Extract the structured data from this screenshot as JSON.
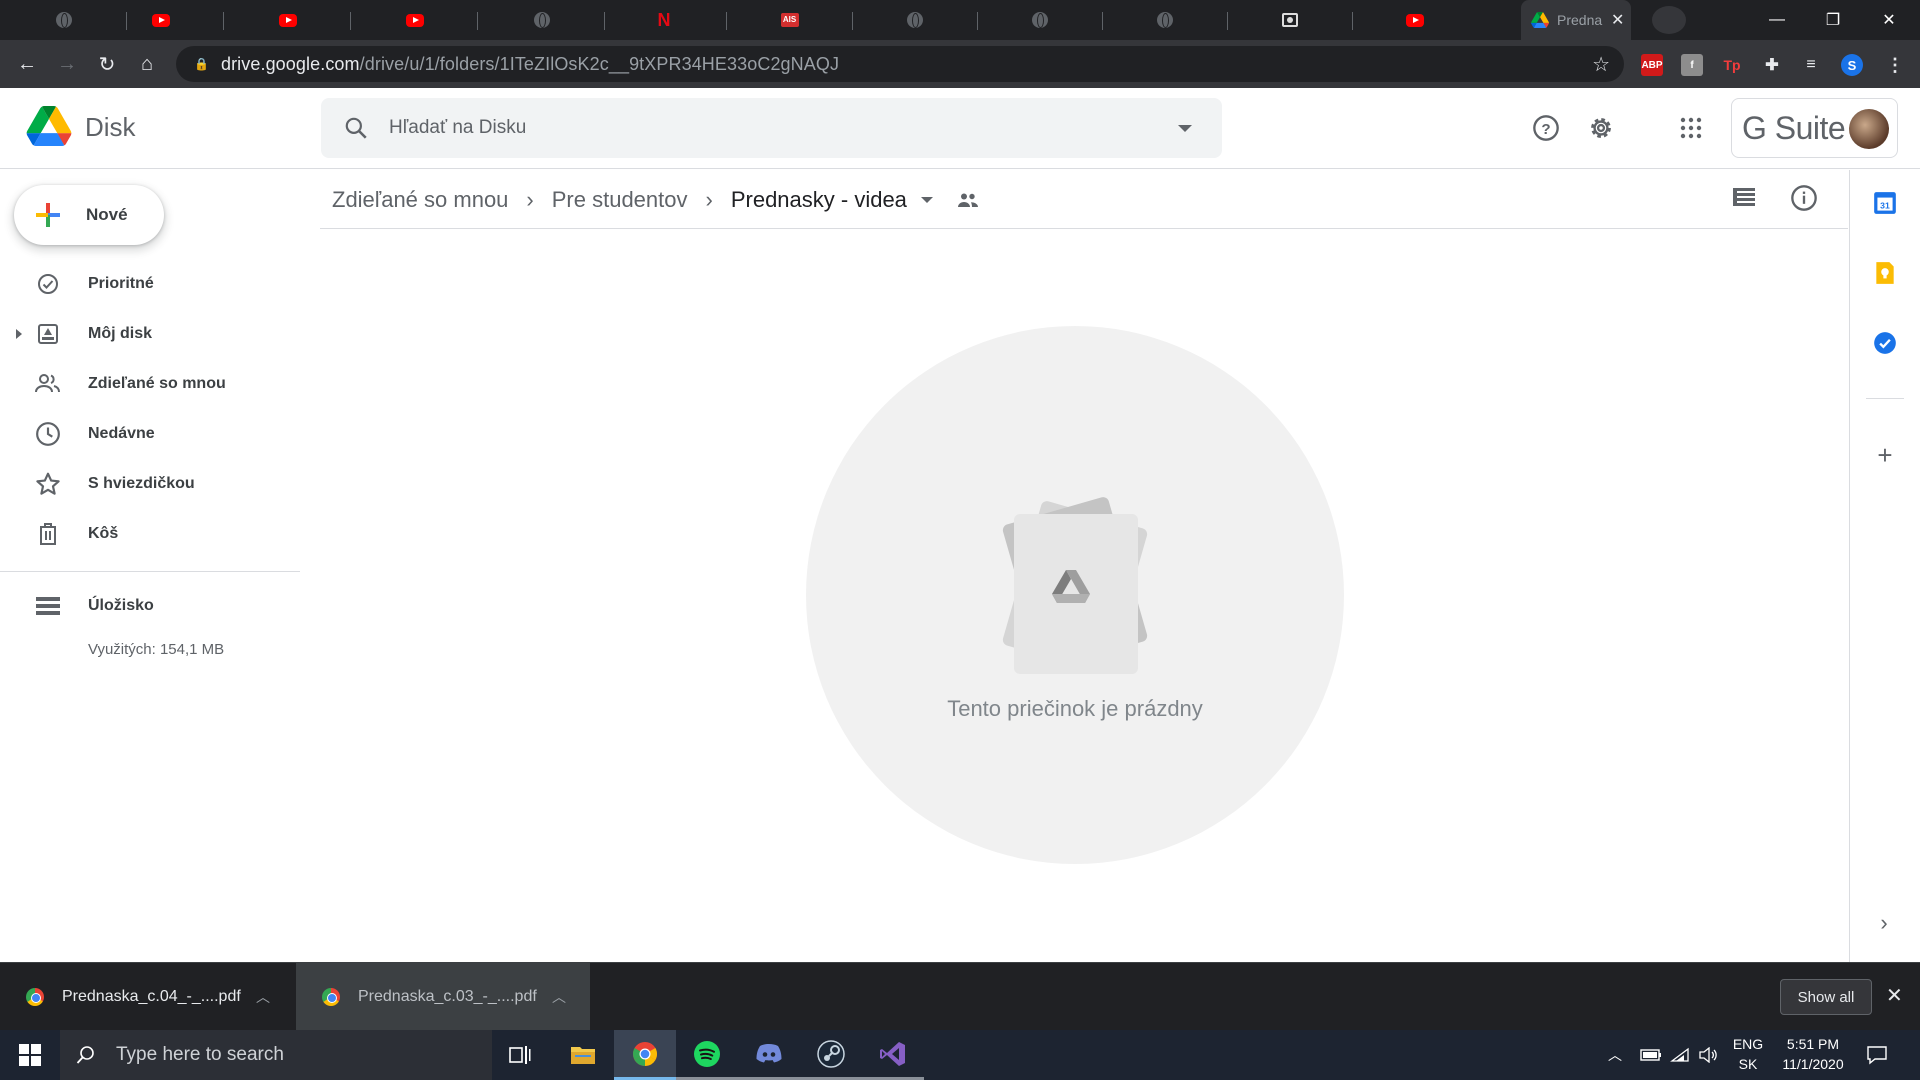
{
  "browser": {
    "tabs": [
      {
        "icon": "globe-icon"
      },
      {
        "icon": "youtube-icon"
      },
      {
        "icon": "youtube-icon"
      },
      {
        "icon": "youtube-icon"
      },
      {
        "icon": "globe-icon"
      },
      {
        "icon": "netflix-icon"
      },
      {
        "icon": "ais-icon"
      },
      {
        "icon": "globe-icon"
      },
      {
        "icon": "globe-icon"
      },
      {
        "icon": "globe-icon"
      },
      {
        "icon": "contact-icon"
      },
      {
        "icon": "youtube-icon"
      }
    ],
    "active_tab": {
      "title": "Predna",
      "icon": "google-drive-icon"
    },
    "url": {
      "host": "drive.google.com",
      "path": "/drive/u/1/folders/1ITeZIlOsK2c__9tXPR34HE33oC2gNAQJ"
    },
    "extensions": [
      "ABP",
      "f",
      "Tp"
    ],
    "profile_initial": "S"
  },
  "drive": {
    "app_name": "Disk",
    "search": {
      "placeholder": "Hľadať na Disku"
    },
    "gsuite_label": "G Suite",
    "new_button": "Nové",
    "sidebar": [
      {
        "id": "priority",
        "label": "Prioritné",
        "icon": "priority-check-icon"
      },
      {
        "id": "my-drive",
        "label": "Môj disk",
        "icon": "my-drive-icon"
      },
      {
        "id": "shared",
        "label": "Zdieľané so mnou",
        "icon": "people-icon"
      },
      {
        "id": "recent",
        "label": "Nedávne",
        "icon": "clock-icon"
      },
      {
        "id": "starred",
        "label": "S hviezdičkou",
        "icon": "star-icon"
      },
      {
        "id": "trash",
        "label": "Kôš",
        "icon": "trash-icon"
      }
    ],
    "storage": {
      "label": "Úložisko",
      "used": "Využitých: 154,1 MB"
    },
    "breadcrumb": [
      "Zdieľané so mnou",
      "Pre studentov",
      "Prednasky - videa"
    ],
    "empty_message": "Tento priečinok je prázdny"
  },
  "downloads": {
    "items": [
      "Prednaska_c.04_-_....pdf",
      "Prednaska_c.03_-_....pdf"
    ],
    "show_all": "Show all"
  },
  "taskbar": {
    "search_placeholder": "Type here to search",
    "apps": [
      "task-view-icon",
      "file-explorer-icon",
      "chrome-icon",
      "spotify-icon",
      "discord-icon",
      "steam-icon",
      "visual-studio-icon"
    ],
    "language": {
      "line1": "ENG",
      "line2": "SK"
    },
    "clock": {
      "time": "5:51 PM",
      "date": "11/1/2020"
    }
  },
  "colors": {
    "drive_blue": "#4285f4",
    "drive_green": "#34a853",
    "drive_yellow": "#fbbc05",
    "drive_red": "#ea4335"
  }
}
